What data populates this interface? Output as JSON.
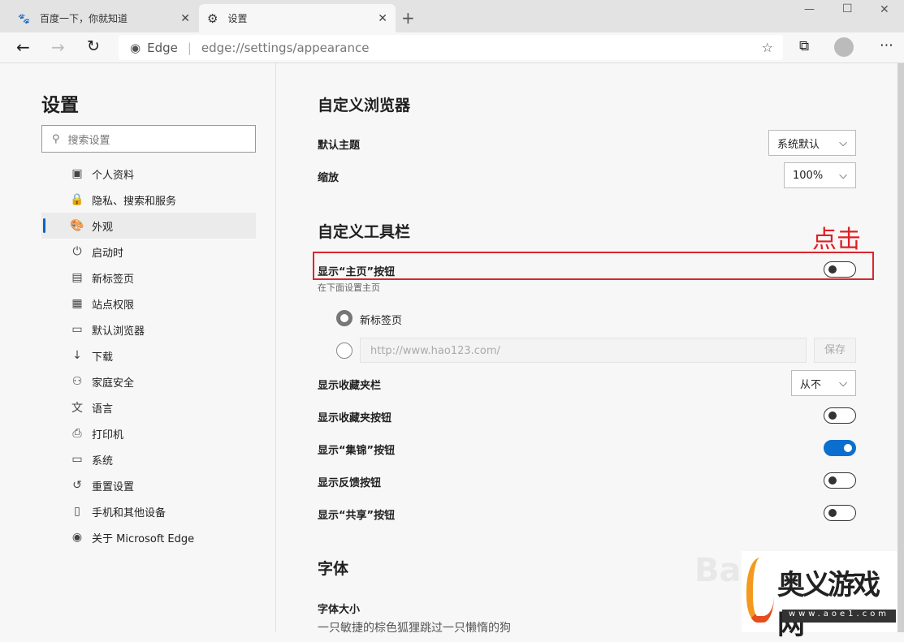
{
  "tabs": [
    {
      "label": "百度一下，你就知道",
      "icon": "baidu-paw-icon"
    },
    {
      "label": "设置",
      "icon": "gear-icon"
    }
  ],
  "address": {
    "site": "Edge",
    "url": "edge://settings/appearance"
  },
  "sidebar": {
    "title": "设置",
    "search_placeholder": "搜索设置",
    "items": [
      {
        "label": "个人资料",
        "icon": "profile-icon"
      },
      {
        "label": "隐私、搜索和服务",
        "icon": "lock-icon"
      },
      {
        "label": "外观",
        "icon": "palette-icon",
        "selected": true
      },
      {
        "label": "启动时",
        "icon": "power-icon"
      },
      {
        "label": "新标签页",
        "icon": "newtab-icon"
      },
      {
        "label": "站点权限",
        "icon": "site-permissions-icon"
      },
      {
        "label": "默认浏览器",
        "icon": "browser-icon"
      },
      {
        "label": "下载",
        "icon": "download-icon"
      },
      {
        "label": "家庭安全",
        "icon": "family-icon"
      },
      {
        "label": "语言",
        "icon": "language-icon"
      },
      {
        "label": "打印机",
        "icon": "printer-icon"
      },
      {
        "label": "系统",
        "icon": "system-icon"
      },
      {
        "label": "重置设置",
        "icon": "reset-icon"
      },
      {
        "label": "手机和其他设备",
        "icon": "phone-icon"
      },
      {
        "label": "关于 Microsoft Edge",
        "icon": "edge-icon"
      }
    ]
  },
  "main": {
    "customize_browser": "自定义浏览器",
    "theme_label": "默认主题",
    "theme_value": "系统默认",
    "zoom_label": "缩放",
    "zoom_value": "100%",
    "customize_toolbar": "自定义工具栏",
    "annotation": "点击",
    "home_label": "显示“主页”按钮",
    "home_on": false,
    "home_sub": "在下面设置主页",
    "radio_newtab": "新标签页",
    "url_placeholder": "http://www.hao123.com/",
    "save": "保存",
    "fav_bar_label": "显示收藏夹栏",
    "fav_bar_value": "从不",
    "toggles": [
      {
        "label": "显示收藏夹按钮",
        "on": false
      },
      {
        "label": "显示“集锦”按钮",
        "on": true
      },
      {
        "label": "显示反馈按钮",
        "on": false
      },
      {
        "label": "显示“共享”按钮",
        "on": false
      }
    ],
    "fonts": "字体",
    "font_size": "字体大小",
    "font_sample": "一只敏捷的棕色狐狸跳过一只懒惰的狗"
  },
  "watermark": {
    "text": "奥义游戏网",
    "url": "www.aoe1.com"
  }
}
